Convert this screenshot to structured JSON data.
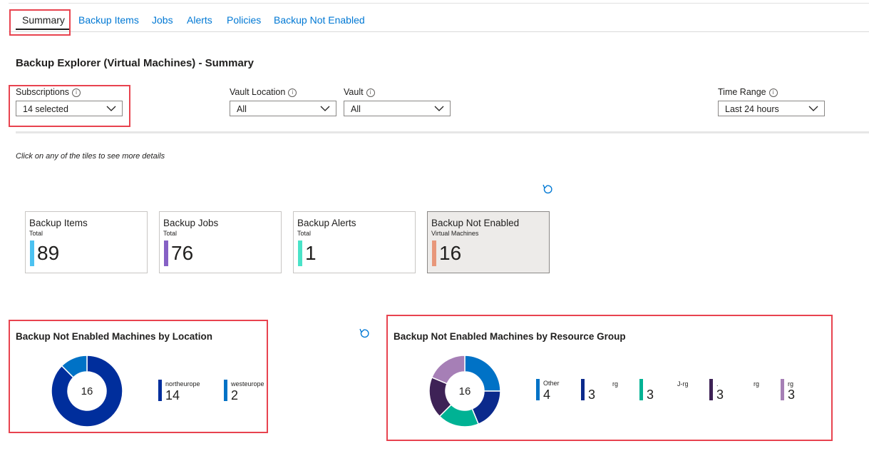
{
  "tabs": [
    {
      "label": "Summary"
    },
    {
      "label": "Backup Items"
    },
    {
      "label": "Jobs"
    },
    {
      "label": "Alerts"
    },
    {
      "label": "Policies"
    },
    {
      "label": "Backup Not Enabled"
    }
  ],
  "page": {
    "title": "Backup Explorer (Virtual Machines) - Summary"
  },
  "filters": {
    "subscriptions": {
      "label": "Subscriptions",
      "value": "14 selected"
    },
    "vault_location": {
      "label": "Vault Location",
      "value": "All"
    },
    "vault": {
      "label": "Vault",
      "value": "All"
    },
    "time_range": {
      "label": "Time Range",
      "value": "Last 24 hours"
    }
  },
  "info_glyph": "i",
  "hint": "Click on any of the tiles to see more details",
  "icons": {
    "info": "info-icon",
    "chevron": "chevron-down-icon",
    "refresh": "refresh-icon"
  },
  "tiles": [
    {
      "title": "Backup Items",
      "subtitle": "Total",
      "value": "89",
      "color": "#4cc2f1"
    },
    {
      "title": "Backup Jobs",
      "subtitle": "Total",
      "value": "76",
      "color": "#8661c5"
    },
    {
      "title": "Backup Alerts",
      "subtitle": "Total",
      "value": "1",
      "color": "#4ae3c8"
    },
    {
      "title": "Backup Not Enabled",
      "subtitle": "Virtual Machines",
      "value": "16",
      "color": "#e8977a"
    }
  ],
  "location_chart": {
    "title": "Backup Not Enabled Machines by Location",
    "total": "16",
    "legend": [
      {
        "name": "northeurope",
        "value": "14"
      },
      {
        "name": "westeurope",
        "value": "2"
      }
    ]
  },
  "rg_chart": {
    "title": "Backup Not Enabled Machines by Resource Group",
    "total": "16",
    "legend": [
      {
        "name": "Other",
        "value": "4"
      },
      {
        "name": "rg",
        "value": "3"
      },
      {
        "name": "J-rg",
        "value": "3"
      },
      {
        "name": ".",
        "value": "3"
      },
      {
        "name": "rg",
        "value": "3"
      },
      {
        "name": "rg",
        "value": "3"
      }
    ]
  },
  "chart_data": [
    {
      "type": "pie",
      "title": "Backup Not Enabled Machines by Location",
      "categories": [
        "northeurope",
        "westeurope"
      ],
      "values": [
        14,
        2
      ],
      "colors": [
        "#002e9c",
        "#0072c6"
      ]
    },
    {
      "type": "pie",
      "title": "Backup Not Enabled Machines by Resource Group",
      "categories": [
        "Other",
        "rg",
        "J-rg",
        ".",
        "rg",
        "rg"
      ],
      "values": [
        4,
        3,
        3,
        3,
        3,
        3
      ],
      "colors": [
        "#0072c6",
        "#0b2a8c",
        "#00b294",
        "#3e2256",
        "#3a1f4f",
        "#a67fb6"
      ],
      "donut_order": [
        0,
        1,
        2,
        3,
        5
      ]
    }
  ]
}
